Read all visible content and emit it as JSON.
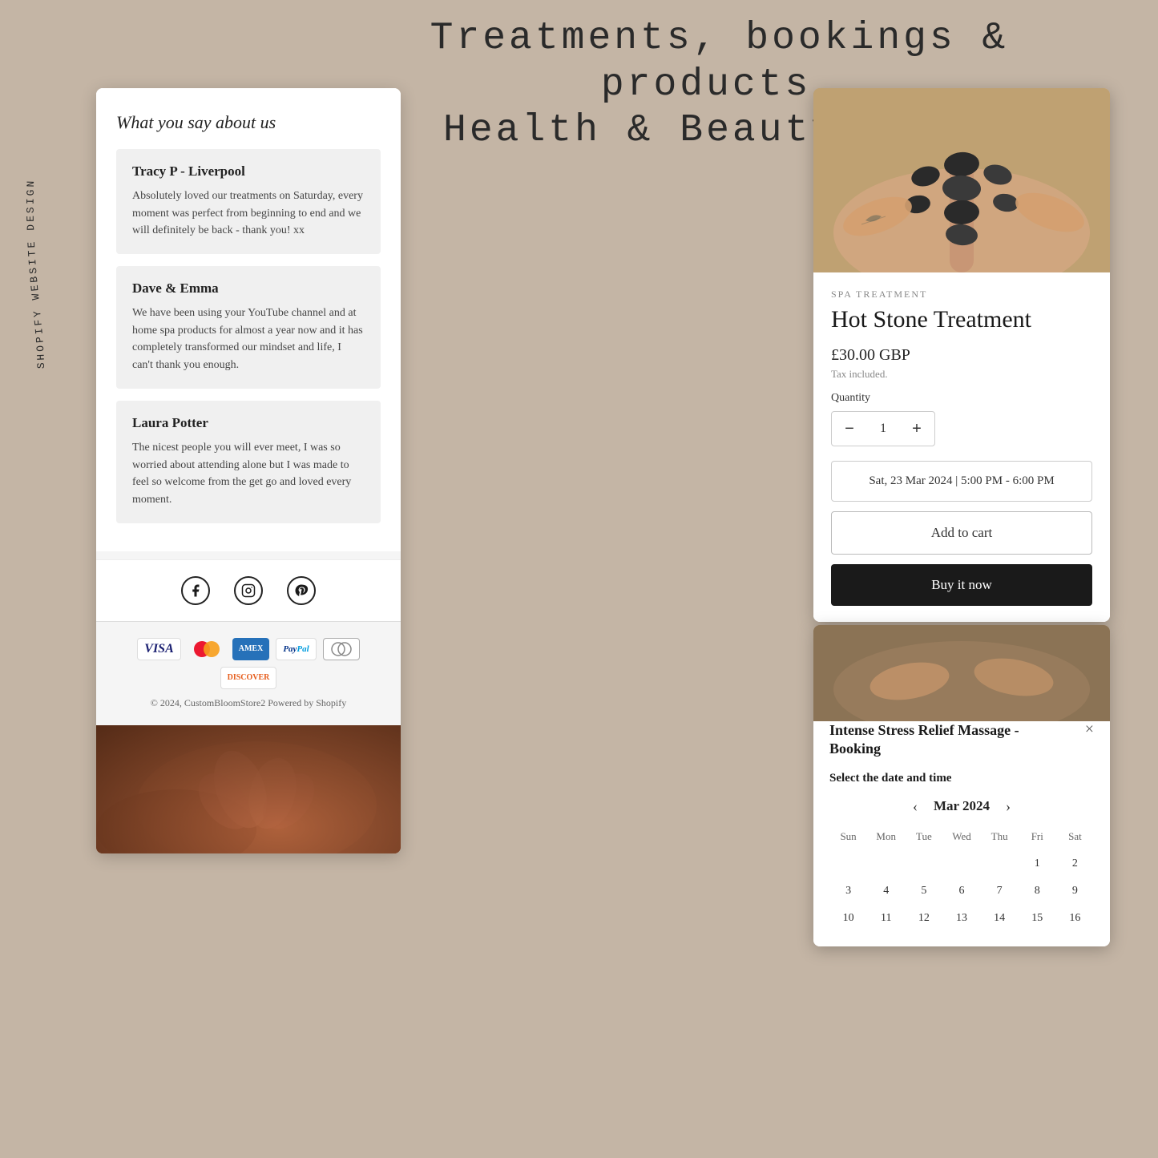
{
  "page": {
    "background_color": "#c4b5a5"
  },
  "header": {
    "line1": "Treatments, bookings & products.",
    "line2": "Health & Beauty Niche",
    "side_text": "SHOPIFY WEBSITE DESIGN"
  },
  "left_panel": {
    "reviews_title": "What you say about us",
    "reviews": [
      {
        "name": "Tracy P - Liverpool",
        "text": "Absolutely loved our treatments on Saturday, every moment was perfect from beginning to end and we will definitely be back - thank you! xx"
      },
      {
        "name": "Dave & Emma",
        "text": "We have been using your YouTube channel and at home spa products for almost a year now and it has completely transformed our mindset and life, I can't thank you enough."
      },
      {
        "name": "Laura Potter",
        "text": "The nicest people you will ever meet, I was so worried about attending alone but I was made to feel so welcome from the get go and loved every moment."
      }
    ],
    "footer": {
      "copyright": "© 2024, CustomBloomStore2 Powered by Shopify"
    },
    "payment_methods": [
      "VISA",
      "Mastercard",
      "AMEX",
      "PayPal",
      "Diners",
      "Discover"
    ]
  },
  "right_panel": {
    "product": {
      "category": "SPA TREATMENT",
      "title": "Hot Stone Treatment",
      "price": "£30.00 GBP",
      "tax_note": "Tax included.",
      "quantity_label": "Quantity",
      "quantity_value": "1",
      "date_time": "Sat, 23 Mar 2024 | 5:00 PM - 6:00 PM",
      "add_to_cart": "Add to cart",
      "buy_now": "Buy it now"
    },
    "booking": {
      "title": "Intense Stress Relief Massage - Booking",
      "subtitle": "Select the date and time",
      "month": "Mar 2024",
      "day_headers": [
        "Sun",
        "Mon",
        "Tue",
        "Wed",
        "Thu",
        "Fri",
        "Sat"
      ],
      "weeks": [
        [
          "",
          "",
          "",
          "",
          "",
          "1",
          "2"
        ],
        [
          "3",
          "4",
          "5",
          "6",
          "7",
          "8",
          "9"
        ],
        [
          "10",
          "11",
          "12",
          "13",
          "14",
          "15",
          "16"
        ]
      ],
      "close_label": "×"
    }
  },
  "icons": {
    "facebook": "f",
    "instagram": "📷",
    "pinterest": "p",
    "prev_arrow": "‹",
    "next_arrow": "›",
    "minus": "−",
    "plus": "+"
  }
}
